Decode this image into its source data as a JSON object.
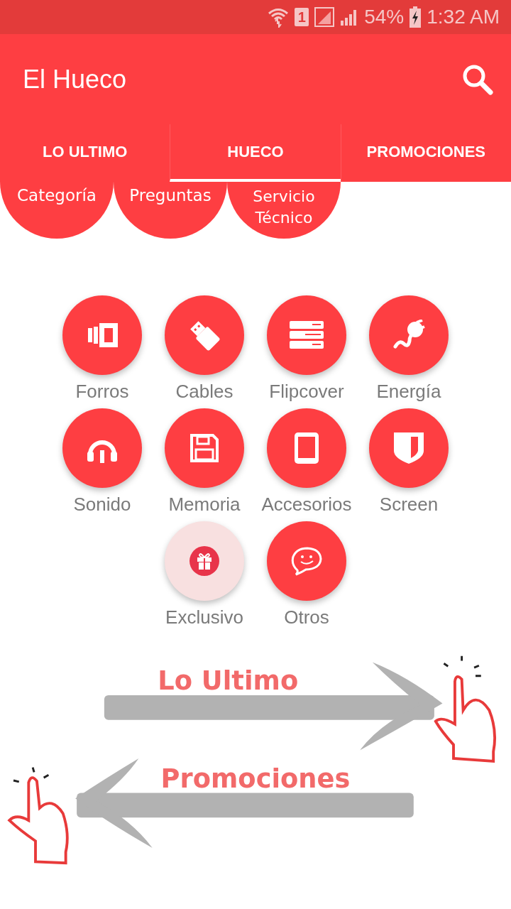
{
  "status_bar": {
    "battery": "54%",
    "time": "1:32 AM",
    "sim": "1"
  },
  "app_bar": {
    "title": "El Hueco"
  },
  "tabs": [
    {
      "label": "LO ULTIMO",
      "selected": false
    },
    {
      "label": "HUECO",
      "selected": true
    },
    {
      "label": "PROMOCIONES",
      "selected": false
    }
  ],
  "subtabs": [
    {
      "label": "Categoría"
    },
    {
      "label": "Preguntas"
    },
    {
      "label": "Servicio Técnico"
    }
  ],
  "categories": [
    {
      "label": "Forros",
      "kind": "case",
      "highlighted": false
    },
    {
      "label": "Cables",
      "kind": "usb",
      "highlighted": false
    },
    {
      "label": "Flipcover",
      "kind": "stack",
      "highlighted": false
    },
    {
      "label": "Energía",
      "kind": "plug",
      "highlighted": false
    },
    {
      "label": "Sonido",
      "kind": "headphones",
      "highlighted": false
    },
    {
      "label": "Memoria",
      "kind": "floppy",
      "highlighted": false
    },
    {
      "label": "Accesorios",
      "kind": "tablet",
      "highlighted": false
    },
    {
      "label": "Screen",
      "kind": "shield",
      "highlighted": false
    },
    {
      "label": "Exclusivo",
      "kind": "gift",
      "highlighted": true
    },
    {
      "label": "Otros",
      "kind": "chat",
      "highlighted": false
    }
  ],
  "swipe_hint": {
    "right_label": "Lo Ultimo",
    "left_label": "Promociones"
  }
}
